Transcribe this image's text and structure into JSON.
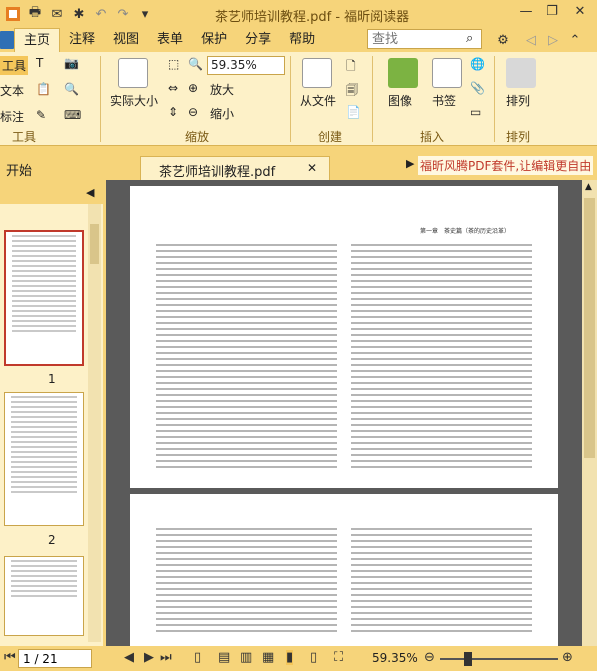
{
  "titlebar": {
    "title": "茶艺师培训教程.pdf - 福昕阅读器",
    "quick_access": [
      "app-logo-icon",
      "print-icon",
      "email-icon",
      "new-icon",
      "undo-icon",
      "redo-icon",
      "customize-icon"
    ],
    "controls": {
      "minimize": "—",
      "restore": "❐",
      "close": "✕"
    }
  },
  "menu": {
    "tabs": [
      "主页",
      "注释",
      "视图",
      "表单",
      "保护",
      "分享",
      "帮助"
    ],
    "active_index": 0,
    "search_placeholder": "查找"
  },
  "ribbon": {
    "tools": {
      "hand": "工具",
      "text": "文本",
      "annotate": "标注",
      "label": "工具"
    },
    "actual_size": "实际大小",
    "zoom": {
      "value": "59.35%",
      "zoom_in": "放大",
      "zoom_out": "缩小",
      "label": "缩放"
    },
    "create": {
      "from_file": "从文件",
      "label": "创建"
    },
    "insert": {
      "image": "图像",
      "bookmark": "书签",
      "label": "插入"
    },
    "sort": {
      "button": "排列",
      "label": "排列"
    }
  },
  "tabs": {
    "home": "开始",
    "document": "茶艺师培训教程.pdf",
    "promo": "福昕风腾PDF套件,让编辑更自由"
  },
  "sidebar": {
    "thumbnails": [
      {
        "label": "1"
      },
      {
        "label": "2"
      }
    ]
  },
  "document": {
    "page1_header": "第一章　茶史篇（茶的历史沿革）"
  },
  "status": {
    "page_display": "1 / 21",
    "zoom_level": "59.35%"
  }
}
